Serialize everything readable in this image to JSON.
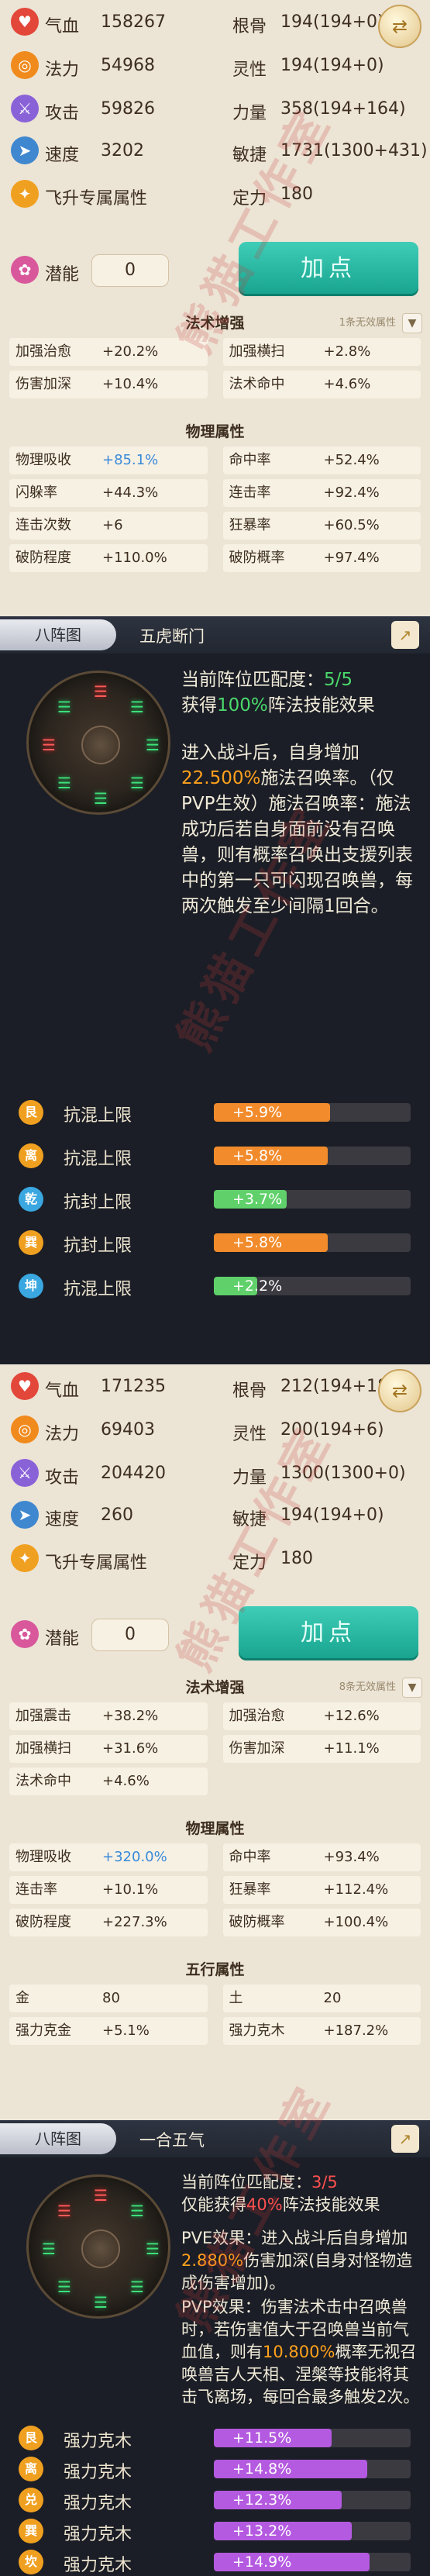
{
  "watermark": "熊猫工作室",
  "panel1": {
    "stats": [
      {
        "icon": "blood-drop-icon",
        "color": "#e2473a",
        "glyph": "♥",
        "label": "气血",
        "value": "158267",
        "label2": "根骨",
        "value2": "194(194+0)"
      },
      {
        "icon": "mana-swirl-icon",
        "color": "#f08a1c",
        "glyph": "◎",
        "label": "法力",
        "value": "54968",
        "label2": "灵性",
        "value2": "194(194+0)"
      },
      {
        "icon": "sword-icon",
        "color": "#8a62d8",
        "glyph": "⚔",
        "label": "攻击",
        "value": "59826",
        "label2": "力量",
        "value2": "358(194+164)"
      },
      {
        "icon": "boot-icon",
        "color": "#3f87cf",
        "glyph": "➤",
        "label": "速度",
        "value": "3202",
        "label2": "敏捷",
        "value2": "1731(1300+431)"
      },
      {
        "icon": "flying-aura-icon",
        "color": "#f0a020",
        "glyph": "✦",
        "label": "飞升专属属性",
        "value": "",
        "label2": "定力",
        "value2": "180"
      }
    ],
    "potential_label": "潜能",
    "potential_value": "0",
    "add_button": "加点",
    "magic": {
      "title": "法术增强",
      "hint": "1条无效属性",
      "cells": [
        {
          "label": "加强治愈",
          "value": "+20.2%"
        },
        {
          "label": "加强横扫",
          "value": "+2.8%"
        },
        {
          "label": "伤害加深",
          "value": "+10.4%"
        },
        {
          "label": "法术命中",
          "value": "+4.6%"
        }
      ]
    },
    "physical": {
      "title": "物理属性",
      "cells": [
        {
          "label": "物理吸收",
          "value": "+85.1%",
          "blue": true
        },
        {
          "label": "命中率",
          "value": "+52.4%"
        },
        {
          "label": "闪躲率",
          "value": "+44.3%"
        },
        {
          "label": "连击率",
          "value": "+92.4%"
        },
        {
          "label": "连击次数",
          "value": "+6"
        },
        {
          "label": "狂暴率",
          "value": "+60.5%"
        },
        {
          "label": "破防程度",
          "value": "+110.0%"
        },
        {
          "label": "破防概率",
          "value": "+97.4%"
        }
      ]
    }
  },
  "formation1": {
    "tab": "八阵图",
    "name": "五虎断门",
    "match_label": "当前阵位匹配度：",
    "match_value": "5/5",
    "effect_pre": "获得",
    "effect_pct": "100%",
    "effect_post": "阵法技能效果",
    "desc_a": "进入战斗后，自身增加",
    "desc_pct": "22.500%",
    "desc_b": "施法召唤率。（仅PVP生效）施法召唤率：施法成功后若自身面前没有召唤兽，则有概率召唤出支援列表中的第一只可闪现召唤兽，每两次触发至少间隔1回合。",
    "bonuses": [
      {
        "icon": "gen-trigram-icon",
        "glyph": "艮",
        "icon_color": "#f0a020",
        "label": "抗混上限",
        "value": "+5.9%",
        "fill": 0.59,
        "bar": "#f28b2b"
      },
      {
        "icon": "li-trigram-icon",
        "glyph": "离",
        "icon_color": "#f0a020",
        "label": "抗混上限",
        "value": "+5.8%",
        "fill": 0.58,
        "bar": "#f28b2b"
      },
      {
        "icon": "qian-trigram-icon",
        "glyph": "乾",
        "icon_color": "#3aa7e0",
        "label": "抗封上限",
        "value": "+3.7%",
        "fill": 0.37,
        "bar": "#5fd06a"
      },
      {
        "icon": "xun-trigram-icon",
        "glyph": "巽",
        "icon_color": "#f0a020",
        "label": "抗封上限",
        "value": "+5.8%",
        "fill": 0.58,
        "bar": "#f28b2b"
      },
      {
        "icon": "kun-trigram-icon",
        "glyph": "坤",
        "icon_color": "#3aa7e0",
        "label": "抗混上限",
        "value": "+2.2%",
        "fill": 0.22,
        "bar": "#5fd06a"
      }
    ]
  },
  "panel2": {
    "stats": [
      {
        "icon": "blood-drop-icon",
        "color": "#e2473a",
        "glyph": "♥",
        "label": "气血",
        "value": "171235",
        "label2": "根骨",
        "value2": "212(194+18)"
      },
      {
        "icon": "mana-swirl-icon",
        "color": "#f08a1c",
        "glyph": "◎",
        "label": "法力",
        "value": "69403",
        "label2": "灵性",
        "value2": "200(194+6)"
      },
      {
        "icon": "sword-icon",
        "color": "#8a62d8",
        "glyph": "⚔",
        "label": "攻击",
        "value": "204420",
        "label2": "力量",
        "value2": "1300(1300+0)"
      },
      {
        "icon": "boot-icon",
        "color": "#3f87cf",
        "glyph": "➤",
        "label": "速度",
        "value": "260",
        "label2": "敏捷",
        "value2": "194(194+0)"
      },
      {
        "icon": "flying-aura-icon",
        "color": "#f0a020",
        "glyph": "✦",
        "label": "飞升专属属性",
        "value": "",
        "label2": "定力",
        "value2": "180"
      }
    ],
    "potential_label": "潜能",
    "potential_value": "0",
    "add_button": "加点",
    "magic": {
      "title": "法术增强",
      "hint": "8条无效属性",
      "cells": [
        {
          "label": "加强震击",
          "value": "+38.2%"
        },
        {
          "label": "加强治愈",
          "value": "+12.6%"
        },
        {
          "label": "加强横扫",
          "value": "+31.6%"
        },
        {
          "label": "伤害加深",
          "value": "+11.1%"
        },
        {
          "label": "法术命中",
          "value": "+4.6%"
        }
      ]
    },
    "physical": {
      "title": "物理属性",
      "cells": [
        {
          "label": "物理吸收",
          "value": "+320.0%",
          "blue": true
        },
        {
          "label": "命中率",
          "value": "+93.4%"
        },
        {
          "label": "连击率",
          "value": "+10.1%"
        },
        {
          "label": "狂暴率",
          "value": "+112.4%"
        },
        {
          "label": "破防程度",
          "value": "+227.3%"
        },
        {
          "label": "破防概率",
          "value": "+100.4%"
        }
      ]
    },
    "elements": {
      "title": "五行属性",
      "cells": [
        {
          "label": "金",
          "value": "80"
        },
        {
          "label": "土",
          "value": "20"
        },
        {
          "label": "强力克金",
          "value": "+5.1%"
        },
        {
          "label": "强力克木",
          "value": "+187.2%"
        }
      ]
    }
  },
  "formation2": {
    "tab": "八阵图",
    "name": "一合五气",
    "match_label": "当前阵位匹配度：",
    "match_value": "3/5",
    "effect_pre": "仅能获得",
    "effect_pct": "40%",
    "effect_post": "阵法技能效果",
    "pve_a": "PVE效果：进入战斗后自身增加",
    "pve_pct": "2.880%",
    "pve_b": "伤害加深(自身对怪物造成伤害增加)。",
    "pvp_a": "PVP效果：伤害法术击中召唤兽时，若伤害值大于召唤兽当前气血值，则有",
    "pvp_pct": "10.800%",
    "pvp_b": "概率无视召唤兽吉人天相、涅槃等技能将其击飞离场，每回合最多触发2次。",
    "bonuses": [
      {
        "icon": "gen-trigram-icon",
        "glyph": "艮",
        "icon_color": "#f0a020",
        "label": "强力克木",
        "value": "+11.5%",
        "fill": 0.6,
        "bar": "#b45ae0"
      },
      {
        "icon": "li-trigram-icon",
        "glyph": "离",
        "icon_color": "#f0a020",
        "label": "强力克木",
        "value": "+14.8%",
        "fill": 0.78,
        "bar": "#b45ae0"
      },
      {
        "icon": "dui-trigram-icon",
        "glyph": "兑",
        "icon_color": "#f0a020",
        "label": "强力克木",
        "value": "+12.3%",
        "fill": 0.65,
        "bar": "#b45ae0"
      },
      {
        "icon": "xun-trigram-icon",
        "glyph": "巽",
        "icon_color": "#f0a020",
        "label": "强力克木",
        "value": "+13.2%",
        "fill": 0.7,
        "bar": "#b45ae0"
      },
      {
        "icon": "kan-trigram-icon",
        "glyph": "坎",
        "icon_color": "#f0a020",
        "label": "强力克木",
        "value": "+14.9%",
        "fill": 0.79,
        "bar": "#b45ae0"
      }
    ]
  }
}
